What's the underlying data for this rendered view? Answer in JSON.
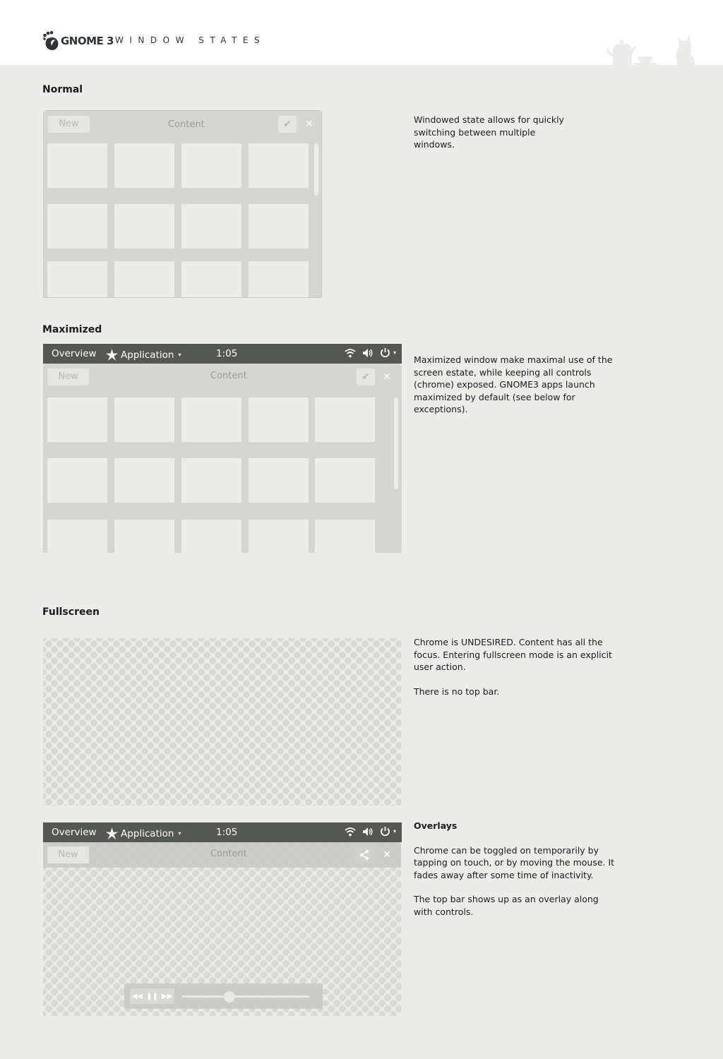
{
  "header": {
    "logo_text": "GNOME 3",
    "subtitle": "WINDOW STATES"
  },
  "sections": {
    "normal": {
      "title": "Normal",
      "description": "Windowed state allows for quickly switching between multiple windows."
    },
    "maximized": {
      "title": "Maximized",
      "description": "Maximized window make maximal use of the screen estate, while keeping all controls (chrome) exposed. GNOME3 apps launch maximized by default (see below for exceptions)."
    },
    "fullscreen": {
      "title": "Fullscreen",
      "description_1": "Chrome is UNDESIRED. Content has all the focus. Entering fullscreen mode is an explicit user action.",
      "description_2": "There is no top bar."
    },
    "overlays": {
      "title": "Overlays",
      "description_1": "Chrome can be toggled on temporarily by tapping on touch, or by moving the mouse. It fades away after some time of inactivity.",
      "description_2": "The top bar shows up as an overlay along with controls."
    }
  },
  "headerbar": {
    "new_label": "New",
    "title": "Content",
    "check_icon": "✔",
    "close_icon": "✕"
  },
  "topbar": {
    "overview_label": "Overview",
    "app_label": "Application",
    "clock": "1:05",
    "dropdown_arrow": "▾"
  },
  "media_controls": {
    "rewind_icon": "◀◀",
    "pause_icon": "❚❚",
    "forward_icon": "▶▶",
    "progress": 0.37
  },
  "colors": {
    "background": "#ececea",
    "header": "#ffffff",
    "window_chrome": "#d5d6cf",
    "topbar": "#555753"
  }
}
